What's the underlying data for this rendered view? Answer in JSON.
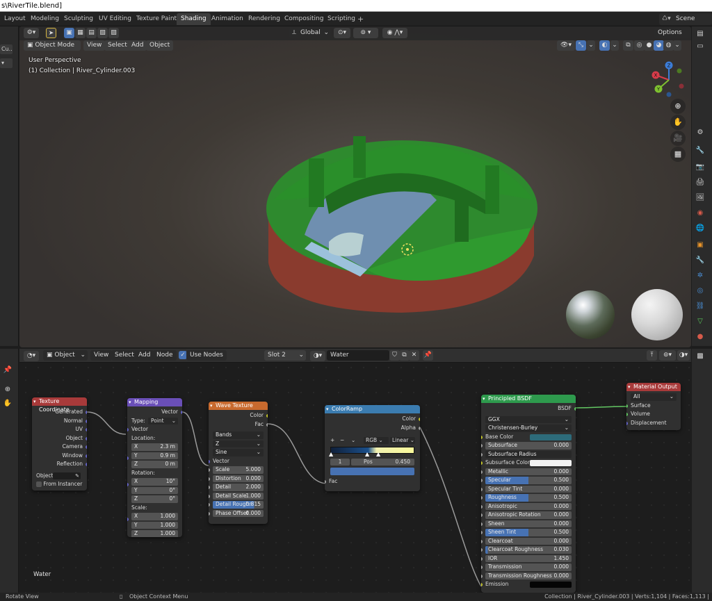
{
  "window": {
    "title": "s\\RiverTile.blend]"
  },
  "workspaces": [
    "Layout",
    "Modeling",
    "Sculpting",
    "UV Editing",
    "Texture Paint",
    "Shading",
    "Animation",
    "Rendering",
    "Compositing",
    "Scripting"
  ],
  "active_workspace": "Shading",
  "scene": {
    "label": "Scene"
  },
  "left_strip": {
    "item1": "Cu...",
    "item2": "▾"
  },
  "viewport": {
    "mode": "Object Mode",
    "menus": [
      "View",
      "Select",
      "Add",
      "Object"
    ],
    "transform_orientation": "Global",
    "options_label": "Options",
    "overlay_title": "User Perspective",
    "overlay_collection": "(1) Collection | River_Cylinder.003",
    "gizmo_axes": {
      "x": "X",
      "y": "Y",
      "z": "Z"
    }
  },
  "node_editor": {
    "editor_type": "Object",
    "menus": [
      "View",
      "Select",
      "Add",
      "Node"
    ],
    "use_nodes_label": "Use Nodes",
    "slot": "Slot 2",
    "material": "Water",
    "frame_label": "Water"
  },
  "nodes": {
    "texcoord": {
      "title": "Texture Coordinate",
      "outputs": [
        "Generated",
        "Normal",
        "UV",
        "Object",
        "Camera",
        "Window",
        "Reflection"
      ],
      "object_label": "Object",
      "from_instancer": "From Instancer",
      "color": "#a83a3a"
    },
    "mapping": {
      "title": "Mapping",
      "output": "Vector",
      "type_label": "Type:",
      "type_value": "Point",
      "vector_label": "Vector",
      "location_label": "Location:",
      "location": [
        {
          "a": "X",
          "v": "2.3 m"
        },
        {
          "a": "Y",
          "v": "0.9 m"
        },
        {
          "a": "Z",
          "v": "0 m"
        }
      ],
      "rotation_label": "Rotation:",
      "rotation": [
        {
          "a": "X",
          "v": "10°"
        },
        {
          "a": "Y",
          "v": "0°"
        },
        {
          "a": "Z",
          "v": "0°"
        }
      ],
      "scale_label": "Scale:",
      "scale": [
        {
          "a": "X",
          "v": "1.000"
        },
        {
          "a": "Y",
          "v": "1.000"
        },
        {
          "a": "Z",
          "v": "1.000"
        }
      ],
      "color": "#6a4fb8"
    },
    "wave": {
      "title": "Wave Texture",
      "outputs": [
        "Color",
        "Fac"
      ],
      "dropdowns": [
        "Bands",
        "Z",
        "Sine"
      ],
      "vector_label": "Vector",
      "fields": [
        {
          "l": "Scale",
          "v": "5.000"
        },
        {
          "l": "Distortion",
          "v": "0.000"
        },
        {
          "l": "Detail",
          "v": "2.000"
        },
        {
          "l": "Detail Scale",
          "v": "1.000"
        },
        {
          "l": "Detail Roughn",
          "v": "0.815"
        },
        {
          "l": "Phase Offset",
          "v": "0.000"
        }
      ],
      "color": "#c86a2e"
    },
    "colorramp": {
      "title": "ColorRamp",
      "outputs": [
        "Color",
        "Alpha"
      ],
      "controls": [
        "+",
        "−",
        "⌄"
      ],
      "color_mode": "RGB",
      "interpolation": "Linear",
      "index": "1",
      "pos_label": "Pos",
      "pos_value": "0.450",
      "fac_label": "Fac",
      "color": "#3b7cb0",
      "selected_stop_color": "#4772b3"
    },
    "bsdf": {
      "title": "Principled BSDF",
      "output": "BSDF",
      "distribution": "GGX",
      "subsurface_method": "Christensen-Burley",
      "base_color_label": "Base Color",
      "base_color": "#2d6b7a",
      "subsurface_color_label": "Subsurface Color",
      "subsurface_color": "#f2f2f2",
      "emission_label": "Emission",
      "emission_color": "#050505",
      "fields": [
        {
          "l": "Subsurface",
          "v": "0.000",
          "f": 0
        },
        {
          "l": "Subsurface Radius",
          "v": "",
          "f": 0,
          "dd": true
        },
        {
          "l": "Metallic",
          "v": "0.000",
          "f": 0
        },
        {
          "l": "Specular",
          "v": "0.500",
          "f": 0.5
        },
        {
          "l": "Specular Tint",
          "v": "0.000",
          "f": 0
        },
        {
          "l": "Roughness",
          "v": "0.500",
          "f": 0.5
        },
        {
          "l": "Anisotropic",
          "v": "0.000",
          "f": 0
        },
        {
          "l": "Anisotropic Rotation",
          "v": "0.000",
          "f": 0
        },
        {
          "l": "Sheen",
          "v": "0.000",
          "f": 0
        },
        {
          "l": "Sheen Tint",
          "v": "0.500",
          "f": 0.5
        },
        {
          "l": "Clearcoat",
          "v": "0.000",
          "f": 0
        },
        {
          "l": "Clearcoat Roughness",
          "v": "0.030",
          "f": 0.03
        },
        {
          "l": "IOR",
          "v": "1.450",
          "f": 0
        },
        {
          "l": "Transmission",
          "v": "0.000",
          "f": 0
        },
        {
          "l": "Transmission Roughness",
          "v": "0.000",
          "f": 0
        }
      ],
      "color": "#2e9a4d"
    },
    "output": {
      "title": "Material Output",
      "target": "All",
      "inputs": [
        "Surface",
        "Volume",
        "Displacement"
      ],
      "color": "#a83a3a"
    }
  },
  "statusbar": {
    "left": "Rotate View",
    "middle": "Object Context Menu",
    "right": "Collection | River_Cylinder.003 | Verts:1,104 | Faces:1,113 |"
  }
}
